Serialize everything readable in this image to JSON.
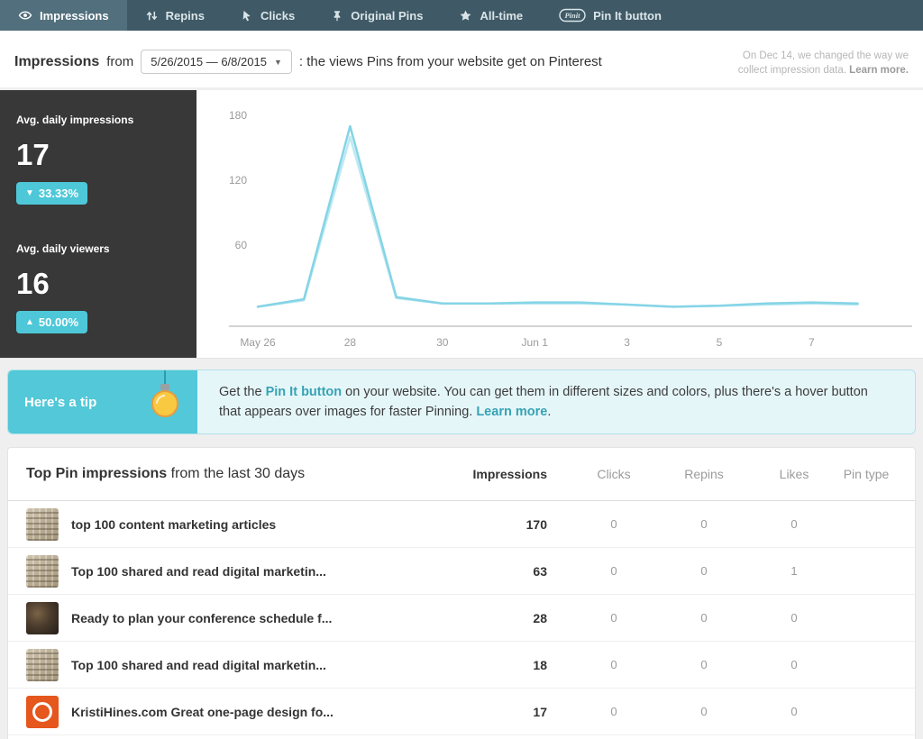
{
  "nav": {
    "tabs": [
      {
        "label": "Impressions",
        "icon": "eye-icon",
        "active": true
      },
      {
        "label": "Repins",
        "icon": "repin-icon",
        "active": false
      },
      {
        "label": "Clicks",
        "icon": "cursor-icon",
        "active": false
      },
      {
        "label": "Original Pins",
        "icon": "pushpin-icon",
        "active": false
      },
      {
        "label": "All-time",
        "icon": "star-icon",
        "active": false
      },
      {
        "label": "Pin It button",
        "icon": "pinit-badge-icon",
        "active": false
      }
    ]
  },
  "header": {
    "title": "Impressions",
    "from_label": "from",
    "date_range": "5/26/2015 — 6/8/2015",
    "subtitle": ": the views Pins from your website get on Pinterest",
    "note_line1": "On Dec 14, we changed the way we",
    "note_line2": "collect impression data.",
    "note_link": "Learn more."
  },
  "stats": {
    "impressions": {
      "label": "Avg. daily impressions",
      "value": "17",
      "change": "33.33%",
      "direction": "down"
    },
    "viewers": {
      "label": "Avg. daily viewers",
      "value": "16",
      "change": "50.00%",
      "direction": "up"
    }
  },
  "chart_data": {
    "type": "line",
    "title": "Daily impressions 5/26/2015 — 6/8/2015",
    "x_labels": [
      "May 26",
      "28",
      "30",
      "Jun 1",
      "3",
      "5",
      "7"
    ],
    "x_label_days": [
      0,
      2,
      4,
      6,
      8,
      10,
      12
    ],
    "days": 14,
    "ylim": [
      0,
      180
    ],
    "yticks": [
      60,
      120,
      180
    ],
    "grid": false,
    "legend": "none",
    "series": [
      {
        "name": "Impressions",
        "color": "#85d4e6",
        "values": [
          3,
          10,
          170,
          12,
          6,
          6,
          7,
          7,
          5,
          3,
          4,
          6,
          7,
          6
        ]
      },
      {
        "name": "Viewers",
        "color": "#bce9f2",
        "values": [
          3,
          9,
          160,
          11,
          6,
          6,
          6,
          6,
          5,
          3,
          4,
          5,
          6,
          5
        ]
      }
    ]
  },
  "tip": {
    "label": "Here's a tip",
    "text_before": "Get the ",
    "link1": "Pin It button",
    "text_middle": " on your website. You can get them in different sizes and colors, plus there's a hover button that appears over images for faster Pinning. ",
    "link2": "Learn more",
    "text_after": "."
  },
  "table": {
    "title_bold": "Top Pin impressions",
    "title_rest": " from the last 30 days",
    "columns": [
      "Impressions",
      "Clicks",
      "Repins",
      "Likes",
      "Pin type"
    ],
    "rows": [
      {
        "title": "top 100 content marketing articles",
        "impressions": "170",
        "clicks": "0",
        "repins": "0",
        "likes": "0",
        "pin_type": "",
        "thumb": "keys"
      },
      {
        "title": "Top 100 shared and read digital marketin...",
        "impressions": "63",
        "clicks": "0",
        "repins": "0",
        "likes": "1",
        "pin_type": "",
        "thumb": "keys"
      },
      {
        "title": "Ready to plan your conference schedule f...",
        "impressions": "28",
        "clicks": "0",
        "repins": "0",
        "likes": "0",
        "pin_type": "",
        "thumb": "conference"
      },
      {
        "title": "Top 100 shared and read digital marketin...",
        "impressions": "18",
        "clicks": "0",
        "repins": "0",
        "likes": "0",
        "pin_type": "",
        "thumb": "keys"
      },
      {
        "title": "KristiHines.com Great one-page design fo...",
        "impressions": "17",
        "clicks": "0",
        "repins": "0",
        "likes": "0",
        "pin_type": "",
        "thumb": "logo-orange"
      }
    ]
  },
  "colors": {
    "nav_bg": "#3f5a66",
    "nav_active_bg": "#516f7c",
    "accent_teal": "#4ec8d8",
    "tip_left_bg": "#52c8d8",
    "tip_bg": "#e5f6f9",
    "link_teal": "#36a3b4",
    "stats_bg": "#383838",
    "chart_line": "#85d4e6",
    "chart_line_light": "#bce9f2"
  }
}
